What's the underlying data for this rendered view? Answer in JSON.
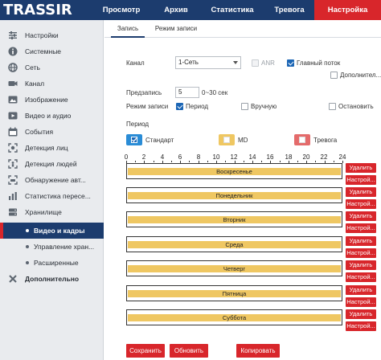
{
  "app": {
    "logo": "TRASSIR"
  },
  "top_nav": {
    "tabs": [
      {
        "label": "Просмотр",
        "active": false
      },
      {
        "label": "Архив",
        "active": false
      },
      {
        "label": "Статистика",
        "active": false
      },
      {
        "label": "Тревога",
        "active": false
      },
      {
        "label": "Настройка",
        "active": true
      }
    ]
  },
  "sidebar": {
    "items": [
      {
        "label": "Настройки",
        "icon": "sliders-icon"
      },
      {
        "label": "Системные",
        "icon": "info-icon"
      },
      {
        "label": "Сеть",
        "icon": "network-icon"
      },
      {
        "label": "Канал",
        "icon": "camera-icon"
      },
      {
        "label": "Изображение",
        "icon": "image-icon"
      },
      {
        "label": "Видео и аудио",
        "icon": "video-audio-icon"
      },
      {
        "label": "События",
        "icon": "events-icon"
      },
      {
        "label": "Детекция лиц",
        "icon": "face-detect-icon"
      },
      {
        "label": "Детекция людей",
        "icon": "people-detect-icon"
      },
      {
        "label": "Обнаружение авт...",
        "icon": "vehicle-detect-icon"
      },
      {
        "label": "Статистика пересе...",
        "icon": "statistics-icon"
      },
      {
        "label": "Хранилище",
        "icon": "storage-icon"
      },
      {
        "label": "Видео и кадры",
        "sub": true,
        "active": true
      },
      {
        "label": "Управление хран...",
        "sub": true
      },
      {
        "label": "Расширенные",
        "sub": true
      },
      {
        "label": "Дополнительно",
        "icon": "tools-icon"
      }
    ]
  },
  "sub_tabs": [
    {
      "label": "Запись",
      "active": true
    },
    {
      "label": "Режим записи",
      "active": false
    }
  ],
  "form": {
    "channel_label": "Канал",
    "channel_value": "1-Сеть",
    "anr_label": "ANR",
    "anr_checked": false,
    "main_stream_label": "Главный поток",
    "main_stream_checked": true,
    "extra_stream_label": "Дополнител...",
    "extra_stream_checked": false,
    "prerecord_label": "Предзапись",
    "prerecord_value": "5",
    "prerecord_hint": "0~30 сек",
    "record_mode_label": "Режим записи",
    "mode_period_label": "Период",
    "mode_period_checked": true,
    "mode_manual_label": "Вручную",
    "mode_manual_checked": false,
    "mode_stop_label": "Остановить",
    "mode_stop_checked": false,
    "period_section_label": "Период"
  },
  "legend": [
    {
      "label": "Стандарт",
      "color": "#2a8cd6",
      "checked": true
    },
    {
      "label": "MD",
      "color": "#efc762",
      "checked": false
    },
    {
      "label": "Тревога",
      "color": "#e46b6b",
      "checked": false
    }
  ],
  "timeline": {
    "hours": [
      "0",
      "2",
      "4",
      "6",
      "8",
      "10",
      "12",
      "14",
      "16",
      "18",
      "20",
      "22",
      "24"
    ],
    "days": [
      "Воскресенье",
      "Понедельник",
      "Вторник",
      "Среда",
      "Четверг",
      "Пятница",
      "Суббота"
    ],
    "bar_color": "#efc762",
    "delete_label": "Удалить",
    "settings_label": "Настрой..."
  },
  "actions": {
    "save": "Сохранить",
    "refresh": "Обновить",
    "copy": "Копировать"
  },
  "colors": {
    "nav_bg": "#1c3c6e",
    "accent_red": "#d8262b"
  }
}
